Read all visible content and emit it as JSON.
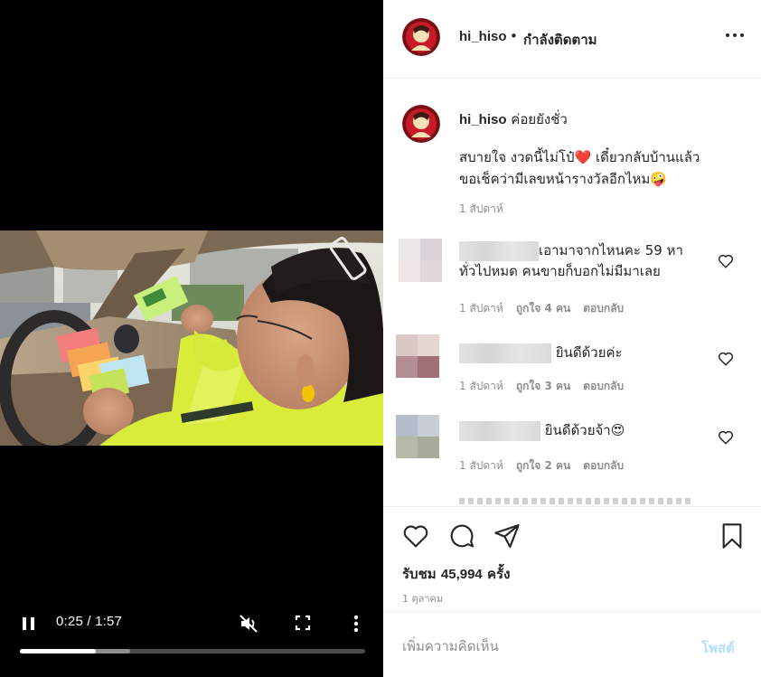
{
  "video": {
    "time": "0:25 / 1:57",
    "progress": 0.22,
    "buffered": 0.32,
    "controls": {
      "pause_icon": "pause-icon",
      "mute_icon": "muted-speaker-icon",
      "fullscreen_icon": "fullscreen-icon",
      "more_icon": "vertical-dots-icon"
    }
  },
  "header": {
    "username": "hi_hiso",
    "separator": "•",
    "follow_status": "กำลังติดตาม",
    "more_icon": "more-horizontal-icon"
  },
  "caption": {
    "username": "hi_hiso",
    "text_inline": "ค่อยยังชั่ว",
    "line1": "สบายใจ งวดนี้ไม่โป๋",
    "line1_after_heart": " เดี๋ยวกลับบ้านแล้ว",
    "line2": "ขอเช็คว่ามีเลขหน้ารางวัลอีกไหม",
    "heart_emoji": "❤️",
    "wink_emoji": "🤪",
    "time": "1 สัปดาห์"
  },
  "comments": [
    {
      "text_line1": "เอามาจากไหนคะ 59 หา",
      "text_line2": "ทั่วไปหมด คนขายก็บอกไม่มีมาเลย",
      "emoji": "",
      "time": "1 สัปดาห์",
      "likes": "ถูกใจ 4 คน",
      "reply": "ตอบกลับ",
      "avatar_colors": [
        "#e9e6e8",
        "#d7d3d6",
        "#ece5e3",
        "#e0d7d9"
      ]
    },
    {
      "text_line1": "ยินดีด้วยค่ะ",
      "text_line2": "",
      "emoji": "",
      "time": "1 สัปดาห์",
      "likes": "ถูกใจ 3 คน",
      "reply": "ตอบกลับ",
      "avatar_colors": [
        "#d9c8c4",
        "#e3d6d3",
        "#b48e95",
        "#9f7078"
      ]
    },
    {
      "text_line1": "ยินดีด้วยจ้า",
      "text_line2": "",
      "emoji": "😍",
      "time": "1 สัปดาห์",
      "likes": "ถูกใจ 2 คน",
      "reply": "ตอบกลับ",
      "avatar_colors": [
        "#b5bccb",
        "#c9cdd6",
        "#b7b9a8",
        "#a9ab9a"
      ]
    }
  ],
  "actions": {
    "like_icon": "heart-icon",
    "comment_icon": "comment-bubble-icon",
    "share_icon": "paper-plane-icon",
    "save_icon": "bookmark-icon"
  },
  "views_label": "รับชม",
  "views_count": "45,994",
  "views_unit": "ครั้ง",
  "post_date": "1 ตุลาคม",
  "add_comment": {
    "placeholder": "เพิ่มความคิดเห็น",
    "post_label": "โพสต์"
  }
}
